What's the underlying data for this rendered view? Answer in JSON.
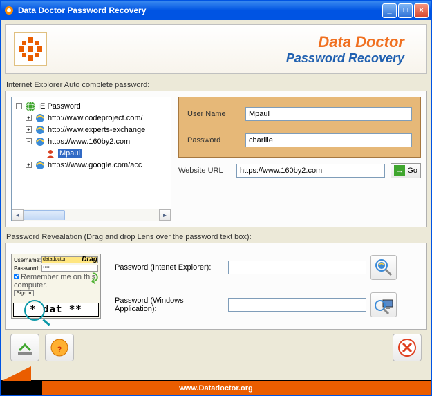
{
  "titlebar": {
    "title": "Data Doctor Password Recovery"
  },
  "banner": {
    "title": "Data Doctor",
    "subtitle": "Password Recovery"
  },
  "section1": {
    "label": "Internet Explorer Auto complete password:",
    "tree": {
      "root": "IE Password",
      "items": [
        {
          "label": "http://www.codeproject.com/",
          "expandable": "+"
        },
        {
          "label": "http://www.experts-exchange",
          "expandable": "+"
        },
        {
          "label": "https://www.160by2.com",
          "expandable": "−"
        },
        {
          "label": "Mpaul",
          "child": true,
          "selected": true
        },
        {
          "label": "https://www.google.com/acc",
          "expandable": "+"
        }
      ]
    },
    "fields": {
      "username_label": "User Name",
      "username_value": "Mpaul",
      "password_label": "Password",
      "password_value": "charllie",
      "url_label": "Website URL",
      "url_value": "https://www.160by2.com",
      "go": "Go"
    }
  },
  "section2": {
    "label": "Password Revealation (Drag and drop Lens over the password text box):",
    "demo": {
      "username_lbl": "Username:",
      "username_val": "datadoctor",
      "password_lbl": "Password:",
      "remember": "Remember me on this computer.",
      "signin": "Sign in",
      "drag": "Drag",
      "masked": "* dat **"
    },
    "ie_label": "Password (Intenet Explorer):",
    "win_label": "Password (Windows Application):"
  },
  "footer": {
    "url": "www.Datadoctor.org"
  }
}
